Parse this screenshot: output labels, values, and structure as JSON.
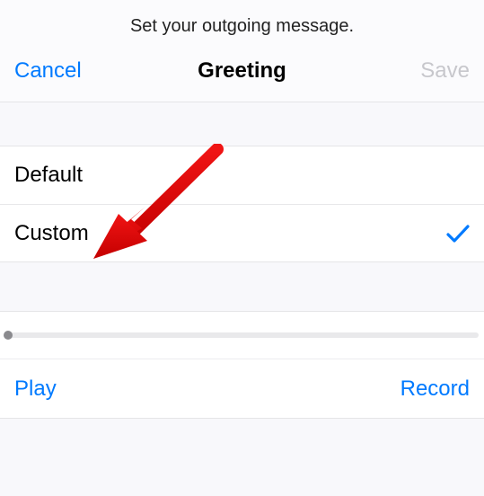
{
  "caption": "Set your outgoing message.",
  "navbar": {
    "cancel_label": "Cancel",
    "title": "Greeting",
    "save_label": "Save"
  },
  "options": {
    "default_label": "Default",
    "custom_label": "Custom",
    "selected": "custom"
  },
  "playback": {
    "play_label": "Play",
    "record_label": "Record",
    "position": 0
  },
  "colors": {
    "tint": "#007aff",
    "disabled": "#c7c7cc"
  }
}
